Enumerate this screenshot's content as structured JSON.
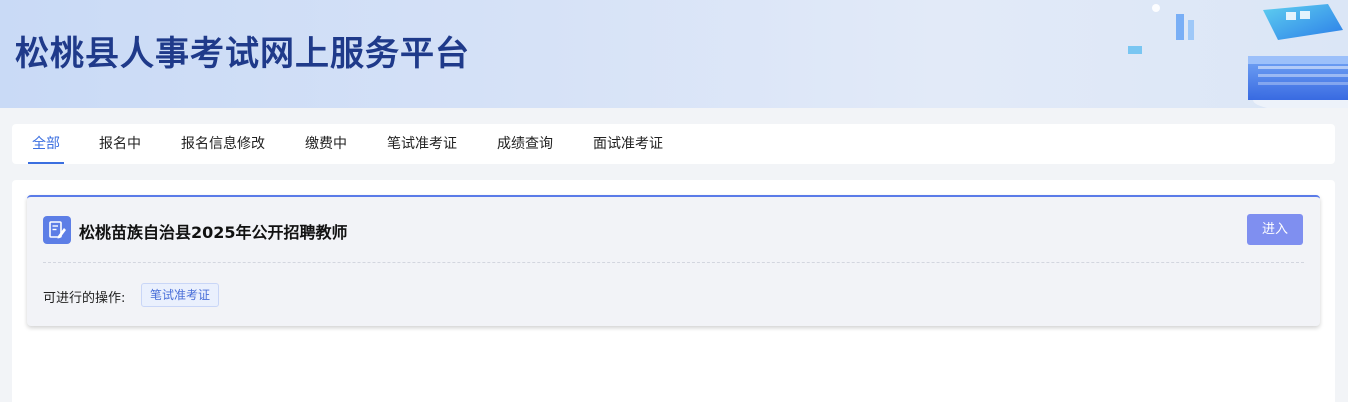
{
  "header": {
    "title": "松桃县人事考试网上服务平台"
  },
  "tabs": [
    {
      "label": "全部",
      "active": true
    },
    {
      "label": "报名中"
    },
    {
      "label": "报名信息修改"
    },
    {
      "label": "缴费中"
    },
    {
      "label": "笔试准考证"
    },
    {
      "label": "成绩查询"
    },
    {
      "label": "面试准考证"
    }
  ],
  "exam_card": {
    "icon": "edit-document-icon",
    "title": "松桃苗族自治县2025年公开招聘教师",
    "enter_button": "进入",
    "operations_label": "可进行的操作:",
    "operations": [
      "笔试准考证"
    ]
  },
  "colors": {
    "accent": "#3b6fe0",
    "title_color": "#1f3a8a",
    "button_bg": "#7f8ff0",
    "card_border": "#5a7be8"
  }
}
